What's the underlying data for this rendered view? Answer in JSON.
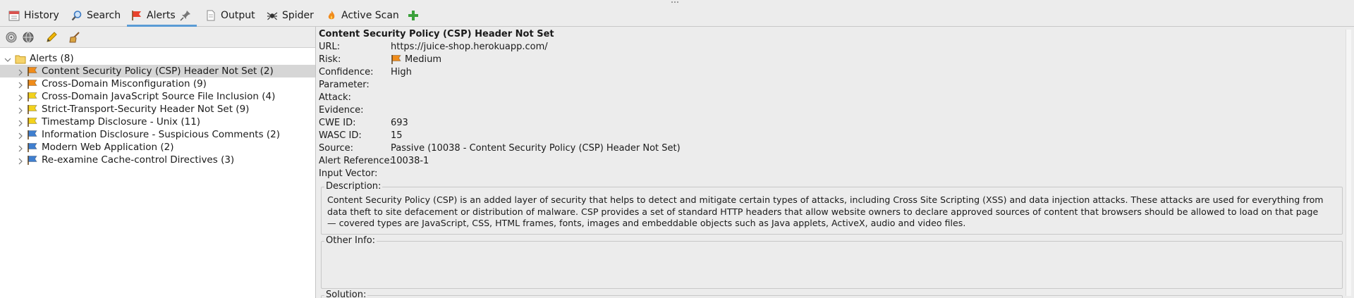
{
  "tabs": [
    {
      "label": "History",
      "icon": "calendar-icon"
    },
    {
      "label": "Search",
      "icon": "search-icon"
    },
    {
      "label": "Alerts",
      "icon": "flag-icon"
    },
    {
      "label": "Output",
      "icon": "document-icon"
    },
    {
      "label": "Spider",
      "icon": "spider-icon"
    },
    {
      "label": "Active Scan",
      "icon": "flame-icon"
    }
  ],
  "tree": {
    "root": "Alerts (8)",
    "items": [
      {
        "label": "Content Security Policy (CSP) Header Not Set (2)",
        "risk": "medium",
        "color": "#f08c1a"
      },
      {
        "label": "Cross-Domain Misconfiguration (9)",
        "risk": "medium",
        "color": "#f08c1a"
      },
      {
        "label": "Cross-Domain JavaScript Source File Inclusion (4)",
        "risk": "low",
        "color": "#f3d21c"
      },
      {
        "label": "Strict-Transport-Security Header Not Set (9)",
        "risk": "low",
        "color": "#f3d21c"
      },
      {
        "label": "Timestamp Disclosure - Unix (11)",
        "risk": "low",
        "color": "#f3d21c"
      },
      {
        "label": "Information Disclosure - Suspicious Comments (2)",
        "risk": "info",
        "color": "#3f7fd0"
      },
      {
        "label": "Modern Web Application (2)",
        "risk": "info",
        "color": "#3f7fd0"
      },
      {
        "label": "Re-examine Cache-control Directives (3)",
        "risk": "info",
        "color": "#3f7fd0"
      }
    ]
  },
  "detail": {
    "title": "Content Security Policy (CSP) Header Not Set",
    "fields": [
      {
        "key": "URL:",
        "value": "https://juice-shop.herokuapp.com/"
      },
      {
        "key": "Risk:",
        "value": "Medium"
      },
      {
        "key": "Confidence:",
        "value": "High"
      },
      {
        "key": "Parameter:",
        "value": ""
      },
      {
        "key": "Attack:",
        "value": ""
      },
      {
        "key": "Evidence:",
        "value": ""
      },
      {
        "key": "CWE ID:",
        "value": "693"
      },
      {
        "key": "WASC ID:",
        "value": "15"
      },
      {
        "key": "Source:",
        "value": "Passive (10038 - Content Security Policy (CSP) Header Not Set)"
      },
      {
        "key": "Alert Reference:",
        "value": "10038-1"
      },
      {
        "key": "Input Vector:",
        "value": ""
      }
    ],
    "description_label": "Description:",
    "description": "Content Security Policy (CSP) is an added layer of security that helps to detect and mitigate certain types of attacks, including Cross Site Scripting (XSS) and data injection attacks. These attacks are used for everything from data theft to site defacement or distribution of malware. CSP provides a set of standard HTTP headers that allow website owners to declare approved sources of content that browsers should be allowed to load on that page — covered types are JavaScript, CSS, HTML frames, fonts, images and embeddable objects such as Java applets, ActiveX, audio and video files.",
    "other_info_label": "Other Info:",
    "solution_label": "Solution:"
  }
}
